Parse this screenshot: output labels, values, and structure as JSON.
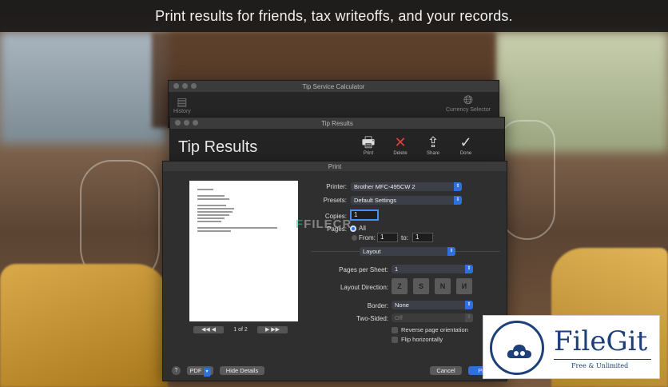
{
  "banner": {
    "text": "Print results for friends, tax writeoffs, and your records."
  },
  "back_window": {
    "title": "Tip Service Calculator",
    "left_icon_label": "History",
    "right_icon_label": "Currency Selector"
  },
  "results_window": {
    "title": "Tip Results",
    "heading": "Tip Results",
    "tools": [
      {
        "label": "Print",
        "icon": "printer-icon",
        "glyph": "🖶"
      },
      {
        "label": "Delete",
        "icon": "delete-icon",
        "glyph": "✕"
      },
      {
        "label": "Share",
        "icon": "share-icon",
        "glyph": "⇪"
      },
      {
        "label": "Done",
        "icon": "checkmark-icon",
        "glyph": "✓"
      }
    ]
  },
  "print_dialog": {
    "title": "Print",
    "pager": {
      "page_text": "1 of 2",
      "prev": "◀◀  ◀",
      "next": "▶  ▶▶"
    },
    "printer": {
      "label": "Printer:",
      "value": "Brother MFC-495CW 2"
    },
    "presets": {
      "label": "Presets:",
      "value": "Default Settings"
    },
    "copies": {
      "label": "Copies:",
      "value": "1"
    },
    "pages": {
      "label": "Pages:",
      "all_label": "All",
      "from_label": "From:",
      "from_value": "1",
      "to_label": "to:",
      "to_value": "1"
    },
    "section": {
      "value": "Layout"
    },
    "pages_per_sheet": {
      "label": "Pages per Sheet:",
      "value": "1"
    },
    "layout_direction": {
      "label": "Layout Direction:"
    },
    "border": {
      "label": "Border:",
      "value": "None"
    },
    "two_sided": {
      "label": "Two-Sided:",
      "value": "Off"
    },
    "reverse": {
      "label": "Reverse page orientation"
    },
    "flip": {
      "label": "Flip horizontally"
    },
    "buttons": {
      "help": "?",
      "pdf": "PDF",
      "hide_details": "Hide Details",
      "cancel": "Cancel",
      "print": "Print"
    }
  },
  "watermark": {
    "text": "FILECR"
  },
  "logo": {
    "name": "FileGit",
    "tagline": "Free & Unlimited"
  },
  "colors": {
    "accent": "#2f6fde",
    "logo_blue": "#1d3f7a"
  }
}
